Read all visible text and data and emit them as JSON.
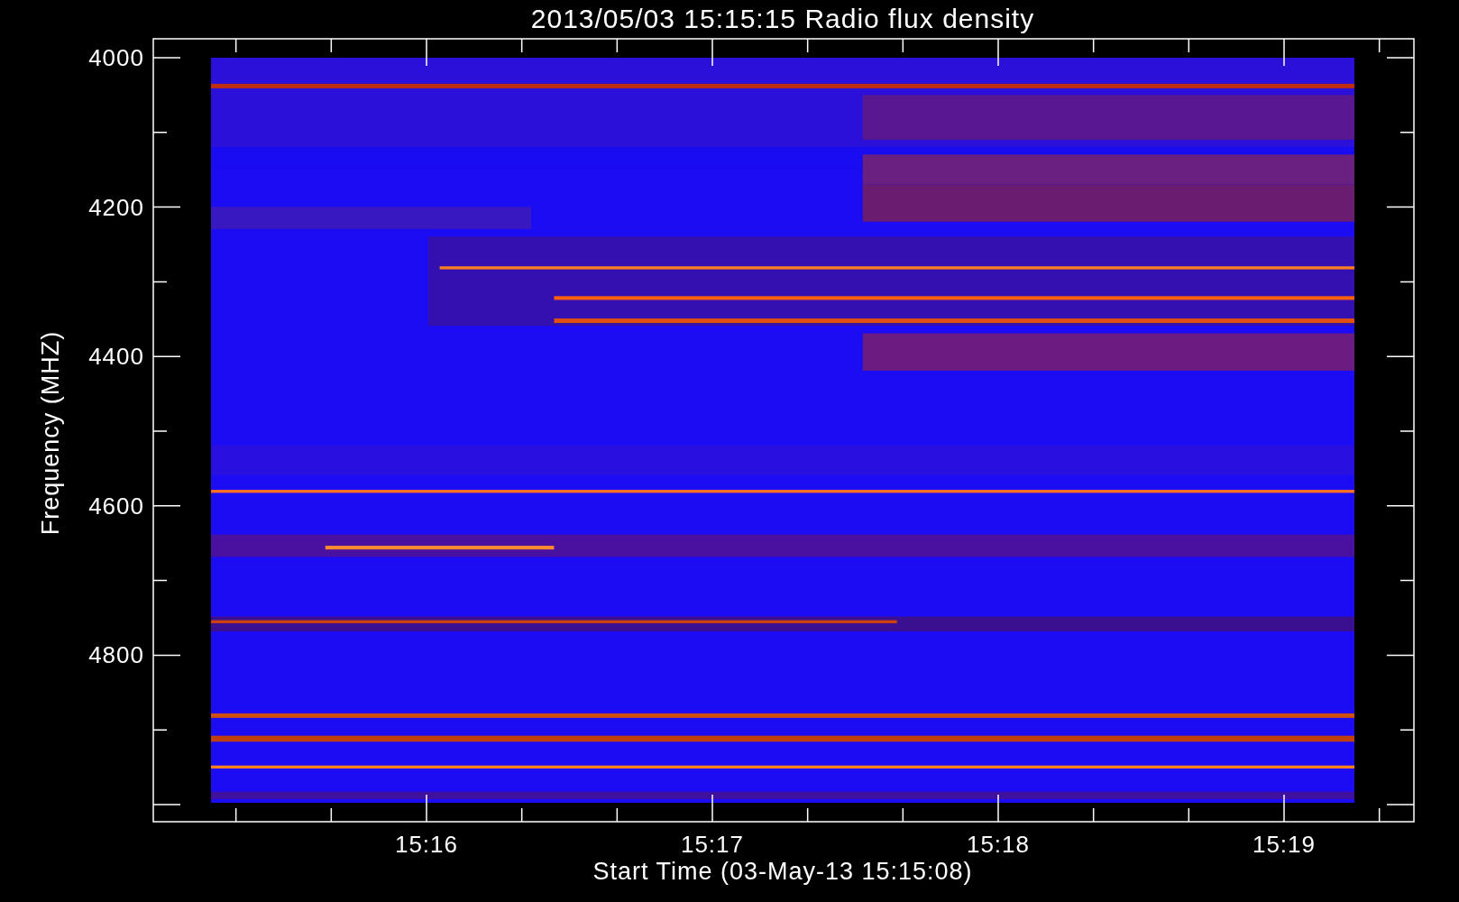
{
  "title": "2013/05/03 15:15:15 Radio flux density",
  "y_axis": {
    "label": "Frequency (MHZ)",
    "ticks": [
      "4000",
      "4200",
      "4400",
      "4600",
      "4800"
    ]
  },
  "x_axis": {
    "label": "Start Time (03-May-13 15:15:08)",
    "ticks": [
      "15:16",
      "15:17",
      "15:18",
      "15:19"
    ]
  }
}
